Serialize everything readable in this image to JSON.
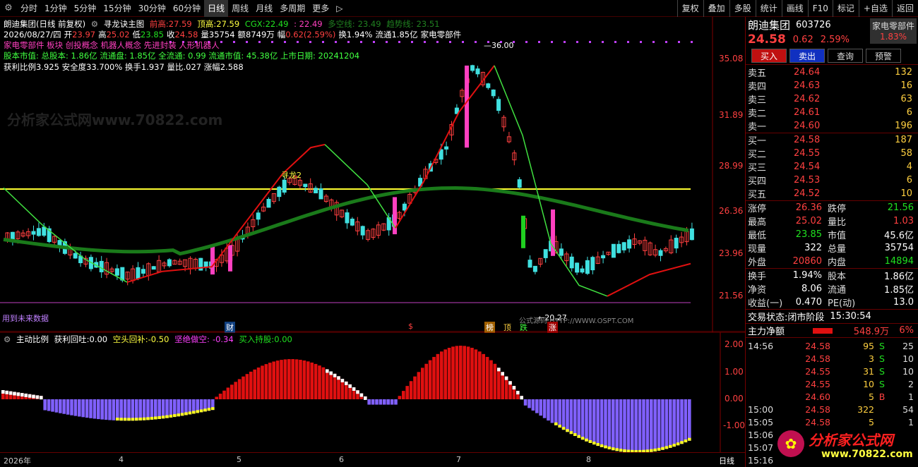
{
  "toolbar": {
    "periods": [
      "分时",
      "1分钟",
      "5分钟",
      "15分钟",
      "30分钟",
      "60分钟",
      "日线",
      "周线",
      "月线",
      "多周期",
      "更多"
    ],
    "active_period": "日线",
    "more_arrow": "▷",
    "buttons": [
      "复权",
      "叠加",
      "多股",
      "统计",
      "画线",
      "F10",
      "标记",
      "+自选",
      "返回"
    ]
  },
  "chart_header": {
    "stock_title": "朗迪集团(日线 前复权)",
    "indicator_name": "寻龙诀主图",
    "prev_high_label": "前高:",
    "prev_high": "27.59",
    "top_high_label": "顶高:",
    "top_high": "27.59",
    "cgx_label": "CGX:",
    "cgx": "22.49",
    "colon_value": ": 22.49",
    "multi_line_label": "多空线:",
    "multi_line": "23.49",
    "trend_line_label": "趋势线:",
    "trend_line": "23.51",
    "date": "2026/08/27/四",
    "open_label": "开",
    "open": "23.97",
    "high_label": "高",
    "high": "25.02",
    "low_label": "低",
    "low": "23.85",
    "close_label": "收",
    "close": "24.58",
    "vol_label": "量",
    "vol": "35754",
    "amount_label": "额",
    "amount": "8749万",
    "amp_label": "幅",
    "amp": "0.62(2.59%)",
    "turnover_label": "换",
    "turnover": "1.94%",
    "float_label": "流通",
    "float": "1.85亿",
    "sector": "家电零部件",
    "concepts": "家电零部件 板块 创投概念 机器人概念 先进封装 人形机器人",
    "capital_line": "股本市值: 总股本: 1.86亿 流通盘: 1.85亿 全流通: 0.99 流通市值: 45.38亿 上市日期: 20241204",
    "profit_line": "获利比例3.925 安全度33.700% 换手1.937 量比.027 涨幅2.588"
  },
  "price_axis": [
    "35.08",
    "31.89",
    "28.99",
    "26.36",
    "23.96",
    "21.56"
  ],
  "annotations": {
    "peak": "36.00",
    "trough": "20.27",
    "future_note": "用到未来数据",
    "xunlong": "寻龙2",
    "signals": [
      "财",
      "$",
      "榜",
      "顶",
      "跌",
      "涨"
    ],
    "site_note": "公式源码 HTTP://WWW.OSPT.COM"
  },
  "sub_header": {
    "name": "主动比例",
    "profit_label": "获利回吐:",
    "profit": "0.00",
    "short_label": "空头回补:",
    "short": "-0.50",
    "bear_label": "坚绝做空:",
    "bear": "-0.34",
    "buy_label": "买入持股:",
    "buy": "0.00"
  },
  "sub_axis": [
    "2.00",
    "1.00",
    "0.00",
    "-1.00"
  ],
  "date_axis": [
    "2026年",
    "4",
    "5",
    "6",
    "7",
    "8"
  ],
  "bottom_right_label": "日线",
  "watermark": "分析家公式网www.70822.com",
  "quote": {
    "name": "朗迪集团",
    "code": "603726",
    "sector_box": "家电零部件",
    "price": "24.58",
    "change": "0.62",
    "change_pct": "2.59%",
    "sector_pct": "1.83%",
    "actions": [
      "买入",
      "卖出",
      "查询",
      "预警"
    ],
    "asks": [
      {
        "label": "卖五",
        "price": "24.64",
        "vol": "132"
      },
      {
        "label": "卖四",
        "price": "24.63",
        "vol": "16"
      },
      {
        "label": "卖三",
        "price": "24.62",
        "vol": "63"
      },
      {
        "label": "卖二",
        "price": "24.61",
        "vol": "6"
      },
      {
        "label": "卖一",
        "price": "24.60",
        "vol": "196"
      }
    ],
    "bids": [
      {
        "label": "买一",
        "price": "24.58",
        "vol": "187"
      },
      {
        "label": "买二",
        "price": "24.55",
        "vol": "58"
      },
      {
        "label": "买三",
        "price": "24.54",
        "vol": "4"
      },
      {
        "label": "买四",
        "price": "24.53",
        "vol": "6"
      },
      {
        "label": "买五",
        "price": "24.52",
        "vol": "10"
      }
    ],
    "stats": [
      {
        "l1": "涨停",
        "v1": "26.36",
        "c1": "red",
        "l2": "跌停",
        "v2": "21.56",
        "c2": "green"
      },
      {
        "l1": "最高",
        "v1": "25.02",
        "c1": "red",
        "l2": "量比",
        "v2": "1.03",
        "c2": "red"
      },
      {
        "l1": "最低",
        "v1": "23.85",
        "c1": "green",
        "l2": "市值",
        "v2": "45.6亿",
        "c2": "white"
      },
      {
        "l1": "现量",
        "v1": "322",
        "c1": "white",
        "l2": "总量",
        "v2": "35754",
        "c2": "white"
      },
      {
        "l1": "外盘",
        "v1": "20860",
        "c1": "red",
        "l2": "内盘",
        "v2": "14894",
        "c2": "green"
      }
    ],
    "stats2": [
      {
        "l1": "换手",
        "v1": "1.94%",
        "c1": "white",
        "l2": "股本",
        "v2": "1.86亿",
        "c2": "white"
      },
      {
        "l1": "净资",
        "v1": "8.06",
        "c1": "white",
        "l2": "流通",
        "v2": "1.85亿",
        "c2": "white"
      },
      {
        "l1": "收益(一)",
        "v1": "0.470",
        "c1": "white",
        "l2": "PE(动)",
        "v2": "13.0",
        "c2": "white"
      }
    ],
    "trade_status_label": "交易状态:",
    "trade_status": "闭市阶段",
    "trade_time": "15:30:54",
    "main_net_label": "主力净额",
    "main_net": "548.9万",
    "main_net_pct": "6%",
    "ticks": [
      {
        "t": "14:56",
        "p": "24.58",
        "q": "95",
        "d": "S",
        "n": "25"
      },
      {
        "t": "",
        "p": "24.58",
        "q": "3",
        "d": "S",
        "n": "10"
      },
      {
        "t": "",
        "p": "24.55",
        "q": "31",
        "d": "S",
        "n": "10"
      },
      {
        "t": "",
        "p": "24.55",
        "q": "10",
        "d": "S",
        "n": "2"
      },
      {
        "t": "",
        "p": "24.60",
        "q": "5",
        "d": "B",
        "n": "1"
      },
      {
        "t": "15:00",
        "p": "24.58",
        "q": "322",
        "d": "",
        "n": "54"
      },
      {
        "t": "15:05",
        "p": "24.58",
        "q": "5",
        "d": "",
        "n": "1"
      },
      {
        "t": "15:06",
        "p": "",
        "q": "",
        "d": "",
        "n": ""
      },
      {
        "t": "15:07",
        "p": "",
        "q": "",
        "d": "",
        "n": ""
      },
      {
        "t": "15:16",
        "p": "",
        "q": "",
        "d": "",
        "n": ""
      }
    ],
    "logo_text": "分析家公式网",
    "logo_url": "www.70822.com"
  },
  "colors": {
    "up": "#ff4040",
    "down": "#40e0e0",
    "pink": "#ff40c0",
    "trend": "#1a7a1a",
    "red_line": "#e01010",
    "green_line": "#40e040",
    "yellow_line": "#ffff30",
    "purple": "#8060ff"
  }
}
